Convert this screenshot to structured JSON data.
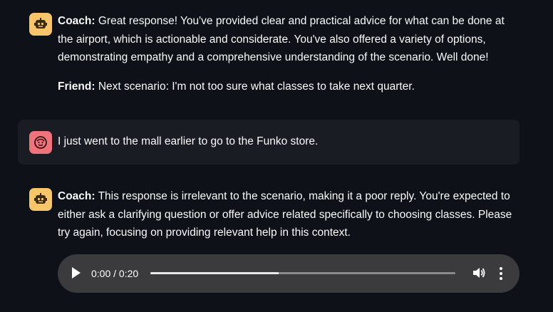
{
  "messages": [
    {
      "role": "assistant",
      "avatar_icon": "robot-icon",
      "paragraphs": [
        {
          "speaker": "Coach:",
          "text": " Great response! You've provided clear and practical advice for what can be done at the airport, which is actionable and considerate. You've also offered a variety of options, demonstrating empathy and a comprehensive understanding of the scenario. Well done!"
        },
        {
          "speaker": "Friend:",
          "text": " Next scenario: I'm not too sure what classes to take next quarter."
        }
      ]
    },
    {
      "role": "user",
      "avatar_icon": "smiley-face-icon",
      "text": "I just went to the mall earlier to go to the Funko store."
    },
    {
      "role": "assistant",
      "avatar_icon": "robot-icon",
      "paragraphs": [
        {
          "speaker": "Coach:",
          "text": " This response is irrelevant to the scenario, making it a poor reply. You're expected to either ask a clarifying question or offer advice related specifically to choosing classes. Please try again, focusing on providing relevant help in this context."
        }
      ]
    }
  ],
  "audio_player": {
    "time_display": "0:00 / 0:20",
    "progress_fraction": 0.42,
    "play_icon": "play-icon",
    "volume_icon": "volume-icon",
    "more_icon": "more-options-icon"
  },
  "colors": {
    "background": "#0e1117",
    "user_message_background": "#1a1c24",
    "assistant_avatar": "#f7c56a",
    "user_avatar": "#f0727a",
    "audio_player_background": "#3b3b3e"
  }
}
